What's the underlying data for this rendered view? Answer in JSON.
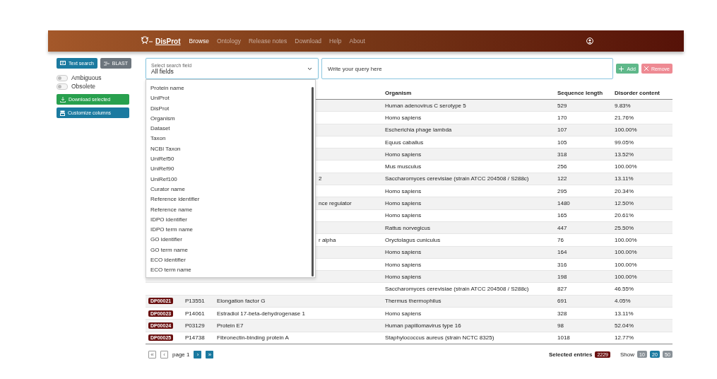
{
  "navbar": {
    "logo": "DisProt",
    "items": [
      {
        "label": "Browse",
        "selected": true
      },
      {
        "label": "Ontology",
        "selected": false
      },
      {
        "label": "Release notes",
        "selected": false
      },
      {
        "label": "Download",
        "selected": false
      },
      {
        "label": "Help",
        "selected": false
      },
      {
        "label": "About",
        "selected": false
      }
    ]
  },
  "sidebar": {
    "modes": [
      {
        "label": "Text search",
        "selected": true,
        "kind": "text"
      },
      {
        "label": "BLAST",
        "selected": false,
        "kind": "blast"
      }
    ],
    "toggles": [
      {
        "label": "Ambiguous",
        "on": false
      },
      {
        "label": "Obsolete",
        "on": false
      }
    ],
    "actions": [
      {
        "label": "Download selected",
        "kind": "download"
      },
      {
        "label": "Customize columns",
        "kind": "columns"
      }
    ]
  },
  "search": {
    "field_label": "Select search field",
    "field_value": "All fields",
    "query_placeholder": "Write your query here",
    "buttons": [
      {
        "label": "Add",
        "kind": "add"
      },
      {
        "label": "Remove",
        "kind": "remove"
      }
    ],
    "options": [
      "Protein name",
      "UniProt",
      "DisProt",
      "Organism",
      "Dataset",
      "Taxon",
      "NCBI Taxon",
      "UniRef50",
      "UniRef90",
      "UniRef100",
      "Curator name",
      "Reference identifier",
      "Reference name",
      "IDPO identifier",
      "IDPO term name",
      "GO identifier",
      "GO term name",
      "ECO identifier",
      "ECO term name"
    ]
  },
  "table": {
    "columns": [
      "Organism",
      "Sequence length",
      "Disorder content"
    ],
    "rows": [
      {
        "kind": "covered",
        "organism": "Human adenovirus C serotype 5",
        "length": "529",
        "disorder": "9.83%"
      },
      {
        "kind": "covered",
        "organism": "Homo sapiens",
        "length": "170",
        "disorder": "21.76%"
      },
      {
        "kind": "covered",
        "organism": "Escherichia phage lambda",
        "length": "107",
        "disorder": "100.00%"
      },
      {
        "kind": "covered",
        "organism": "Equus caballus",
        "length": "105",
        "disorder": "99.05%"
      },
      {
        "kind": "covered",
        "organism": "Homo sapiens",
        "length": "318",
        "disorder": "13.52%"
      },
      {
        "kind": "covered",
        "organism": "Mus musculus",
        "length": "256",
        "disorder": "100.00%"
      },
      {
        "kind": "covered",
        "name": "2",
        "organism": "Saccharomyces cerevisiae (strain ATCC 204508 / S288c)",
        "length": "122",
        "disorder": "13.11%"
      },
      {
        "kind": "covered",
        "organism": "Homo sapiens",
        "length": "295",
        "disorder": "20.34%"
      },
      {
        "kind": "covered",
        "name": "nce regulator",
        "organism": "Homo sapiens",
        "length": "1480",
        "disorder": "12.50%"
      },
      {
        "kind": "covered",
        "organism": "Homo sapiens",
        "length": "165",
        "disorder": "20.61%"
      },
      {
        "kind": "covered",
        "organism": "Rattus norvegicus",
        "length": "447",
        "disorder": "25.50%"
      },
      {
        "kind": "covered",
        "name": "r alpha",
        "organism": "Oryctolagus cuniculus",
        "length": "76",
        "disorder": "100.00%"
      },
      {
        "kind": "covered",
        "organism": "Homo sapiens",
        "length": "164",
        "disorder": "100.00%"
      },
      {
        "kind": "covered",
        "organism": "Homo sapiens",
        "length": "316",
        "disorder": "100.00%"
      },
      {
        "kind": "covered",
        "organism": "Homo sapiens",
        "length": "198",
        "disorder": "100.00%"
      },
      {
        "kind": "covered",
        "organism": "Saccharomyces cerevisiae (strain ATCC 204508 / S288c)",
        "length": "827",
        "disorder": "46.55%"
      },
      {
        "kind": "full",
        "id": "DP00021",
        "accession": "P13551",
        "name": "Elongation factor G",
        "organism": "Thermus thermophilus",
        "length": "691",
        "disorder": "4.05%"
      },
      {
        "kind": "full",
        "id": "DP00023",
        "accession": "P14061",
        "name": "Estradiol 17-beta-dehydrogenase 1",
        "organism": "Homo sapiens",
        "length": "328",
        "disorder": "13.11%"
      },
      {
        "kind": "full",
        "id": "DP00024",
        "accession": "P03129",
        "name": "Protein E7",
        "organism": "Human papillomavirus type 16",
        "length": "98",
        "disorder": "52.04%"
      },
      {
        "kind": "full",
        "id": "DP00025",
        "accession": "P14738",
        "name": "Fibronectin-binding protein A",
        "organism": "Staphylococcus aureus (strain NCTC 8325)",
        "length": "1018",
        "disorder": "12.77%"
      }
    ]
  },
  "pagination": {
    "buttons": [
      {
        "label": "«",
        "disabled": true
      },
      {
        "label": "‹",
        "disabled": true
      },
      {
        "label": "›",
        "disabled": false
      },
      {
        "label": "»",
        "disabled": false
      }
    ],
    "page": "page 1"
  },
  "footer": {
    "selected_label": "Selected entries",
    "selected_count": "2229",
    "show_label": "Show",
    "show_options": [
      {
        "label": "10",
        "selected": false
      },
      {
        "label": "20",
        "selected": true
      },
      {
        "label": "50",
        "selected": false
      }
    ]
  }
}
